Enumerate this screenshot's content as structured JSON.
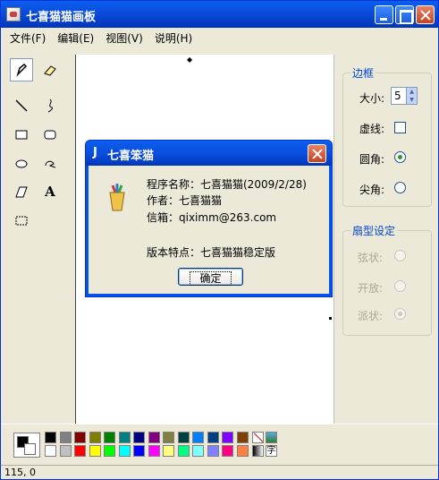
{
  "window": {
    "title": "七喜猫猫画板"
  },
  "menubar": {
    "items": [
      "文件(F)",
      "编辑(E)",
      "视图(V)",
      "说明(H)"
    ]
  },
  "status": {
    "coords": "115, 0"
  },
  "border_panel": {
    "title": "边框",
    "size_label": "大小:",
    "size_value": "5",
    "dashed_label": "虚线:",
    "rounded_label": "圆角:",
    "sharp_label": "尖角:"
  },
  "fan_panel": {
    "title": "扇型设定",
    "arc_label": "弦状:",
    "open_label": "开放:",
    "pie_label": "派状:"
  },
  "dialog": {
    "icon_text": "J",
    "title": "七喜笨猫",
    "program_name": "程序名称：七喜猫猫(2009/2/28)",
    "author": "作者：七喜猫猫",
    "email": "信箱：qiximm@263.com",
    "feature": "版本特点：七喜猫猫稳定版",
    "ok_label": "确定"
  },
  "tools": {
    "text_tool_label": "A"
  },
  "palette": {
    "row1": [
      "#000000",
      "#808080",
      "#800000",
      "#808000",
      "#008000",
      "#008080",
      "#000080",
      "#800080",
      "#808040",
      "#004040",
      "#0080FF",
      "#004080",
      "#8000FF",
      "#804000"
    ],
    "row2": [
      "#FFFFFF",
      "#C0C0C0",
      "#FF0000",
      "#FFFF00",
      "#00FF00",
      "#00FFFF",
      "#0000FF",
      "#FF00FF",
      "#FFFF80",
      "#00FF80",
      "#80FFFF",
      "#8080FF",
      "#FF0080",
      "#FF8040"
    ],
    "extra_label": "字"
  }
}
